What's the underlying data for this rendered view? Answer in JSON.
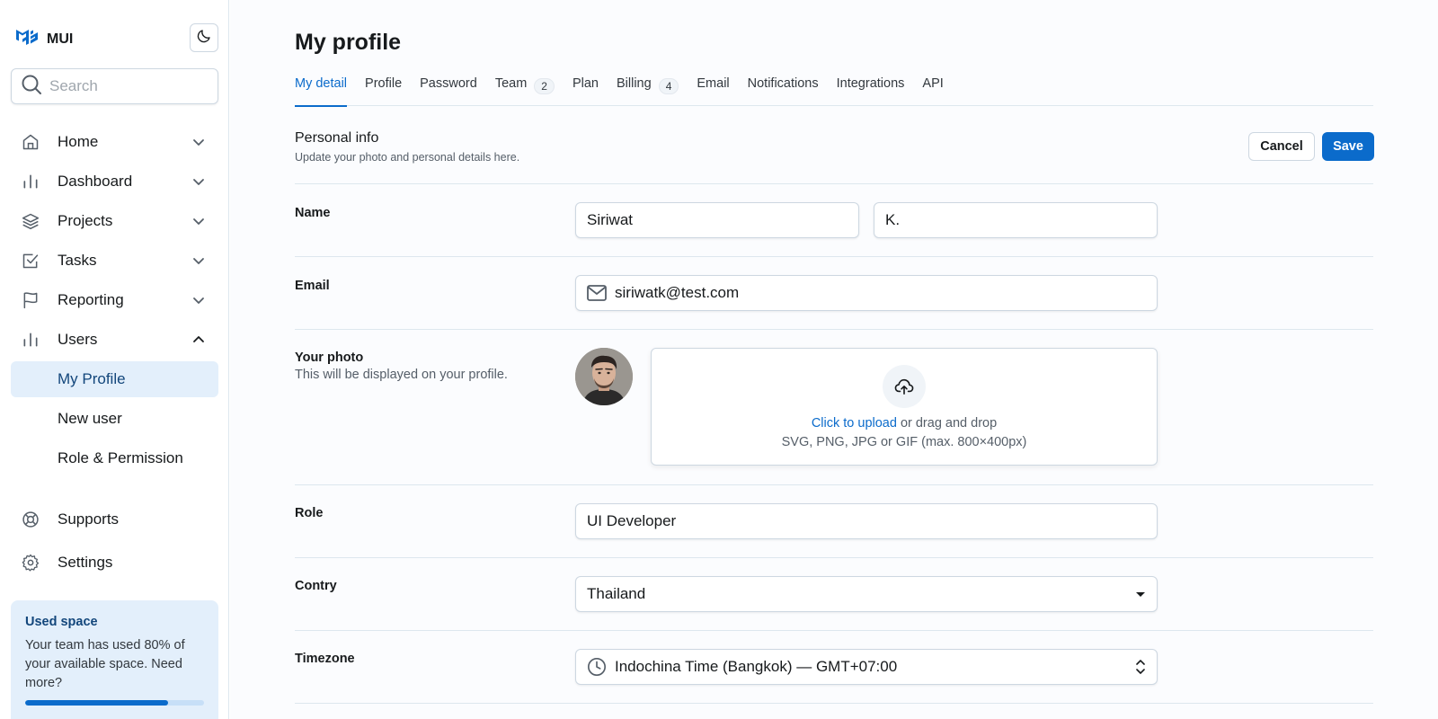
{
  "brand": {
    "name": "MUI"
  },
  "search": {
    "placeholder": "Search"
  },
  "sidebar": {
    "items": [
      {
        "label": "Home",
        "icon": "home-icon"
      },
      {
        "label": "Dashboard",
        "icon": "bar-chart-icon"
      },
      {
        "label": "Projects",
        "icon": "layers-icon"
      },
      {
        "label": "Tasks",
        "icon": "checkbox-icon"
      },
      {
        "label": "Reporting",
        "icon": "flag-icon"
      },
      {
        "label": "Users",
        "icon": "users-chart-icon"
      }
    ],
    "users_subitems": [
      "My Profile",
      "New user",
      "Role & Permission"
    ],
    "bottom_items": [
      {
        "label": "Supports",
        "icon": "lifebuoy-icon"
      },
      {
        "label": "Settings",
        "icon": "gear-icon"
      }
    ]
  },
  "space": {
    "title": "Used space",
    "text": "Your team has used 80% of your available space. Need more?",
    "percent": 80
  },
  "page": {
    "title": "My profile"
  },
  "tabs": [
    {
      "label": "My detail",
      "badge": null
    },
    {
      "label": "Profile",
      "badge": null
    },
    {
      "label": "Password",
      "badge": null
    },
    {
      "label": "Team",
      "badge": "2"
    },
    {
      "label": "Plan",
      "badge": null
    },
    {
      "label": "Billing",
      "badge": "4"
    },
    {
      "label": "Email",
      "badge": null
    },
    {
      "label": "Notifications",
      "badge": null
    },
    {
      "label": "Integrations",
      "badge": null
    },
    {
      "label": "API",
      "badge": null
    }
  ],
  "section": {
    "title": "Personal info",
    "subtitle": "Update your photo and personal details here.",
    "cancel_label": "Cancel",
    "save_label": "Save"
  },
  "form": {
    "name_label": "Name",
    "first_name": "Siriwat",
    "last_name": "K.",
    "email_label": "Email",
    "email": "siriwatk@test.com",
    "photo_label": "Your photo",
    "photo_sub": "This will be displayed on your profile.",
    "upload_link": "Click to upload",
    "upload_rest": " or drag and drop",
    "upload_hint": "SVG, PNG, JPG or GIF (max. 800×400px)",
    "role_label": "Role",
    "role": "UI Developer",
    "country_label": "Contry",
    "country": "Thailand",
    "timezone_label": "Timezone",
    "timezone": "Indochina Time (Bangkok) — GMT+07:00"
  },
  "colors": {
    "accent": "#0b6bcb",
    "active_bg": "#e3effb"
  }
}
